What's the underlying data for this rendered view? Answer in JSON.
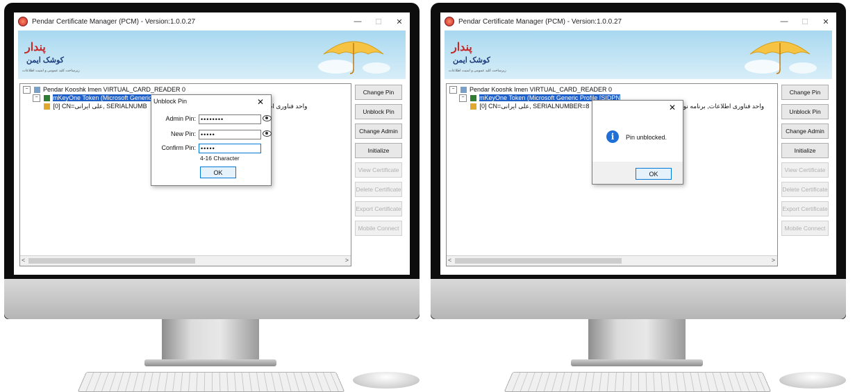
{
  "window": {
    "title": "Pendar Certificate Manager (PCM) - Version:1.0.0.27",
    "minimize_glyph": "—",
    "maximize_glyph": "☐",
    "close_glyph": "✕"
  },
  "banner": {
    "logo_line1": "پندار",
    "logo_line2": "کوشک ایمن",
    "logo_tagline": "زیرساخت کلید عمومی و امنیت اطلاعات"
  },
  "tree_left": {
    "root": "Pendar Kooshk Imen VIRTUAL_CARD_READER 0",
    "token_prefix": "mKeyOne Token (Microsoft Generic P",
    "cert_prefix": "[0] CN=علی ایرانی, SERIALNUMB",
    "cert_suffix": "OU=واحد فناوری اطلاعات, ب"
  },
  "tree_right": {
    "root": "Pendar Kooshk Imen VIRTUAL_CARD_READER 0",
    "token": "mKeyOne Token (Microsoft Generic Profile [SIDPN",
    "cert_prefix": "[0] CN=علی ایرانی, SERIALNUMBER=8",
    "cert_suffix": "OU=واحد فناوری اطلاعات, برنامه نو"
  },
  "side_buttons": {
    "change_pin": "Change Pin",
    "unblock_pin": "Unblock Pin",
    "change_admin": "Change Admin",
    "initialize": "Initialize",
    "view_certificate": "View Certificate",
    "delete_certificate": "Delete Certificate",
    "export_certificate": "Export Certificate",
    "mobile_connect": "Mobile Connect"
  },
  "unblock_dialog": {
    "title": "Unblock Pin",
    "admin_pin_label": "Admin Pin:",
    "admin_pin_value": "••••••••",
    "new_pin_label": "New Pin:",
    "new_pin_value": "•••••",
    "confirm_pin_label": "Confirm Pin:",
    "confirm_pin_value": "•••••",
    "hint": "4-16 Character",
    "ok": "OK",
    "close_glyph": "✕"
  },
  "message_box": {
    "message": "Pin unblocked.",
    "ok": "OK",
    "close_glyph": "✕",
    "icon_glyph": "i"
  },
  "scroll": {
    "left_arrow": "<",
    "right_arrow": ">"
  }
}
